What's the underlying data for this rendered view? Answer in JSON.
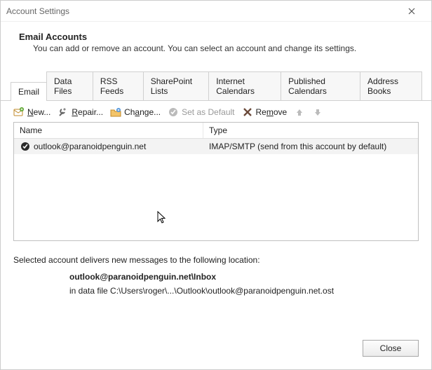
{
  "window": {
    "title": "Account Settings"
  },
  "header": {
    "heading": "Email Accounts",
    "sub": "You can add or remove an account. You can select an account and change its settings."
  },
  "tabs": [
    {
      "id": "email",
      "label": "Email",
      "active": true
    },
    {
      "id": "data-files",
      "label": "Data Files"
    },
    {
      "id": "rss",
      "label": "RSS Feeds"
    },
    {
      "id": "sharepoint",
      "label": "SharePoint Lists"
    },
    {
      "id": "internet-cals",
      "label": "Internet Calendars"
    },
    {
      "id": "pub-cals",
      "label": "Published Calendars"
    },
    {
      "id": "address-books",
      "label": "Address Books"
    }
  ],
  "toolbar": {
    "new": "New...",
    "repair": "Repair...",
    "change": "Change...",
    "set_default": "Set as Default",
    "remove": "Remove"
  },
  "columns": {
    "name": "Name",
    "type": "Type"
  },
  "accounts": [
    {
      "name": "outlook@paranoidpenguin.net",
      "type": "IMAP/SMTP (send from this account by default)"
    }
  ],
  "info": {
    "line1": "Selected account delivers new messages to the following location:",
    "line2": "outlook@paranoidpenguin.net\\Inbox",
    "line3": "in data file C:\\Users\\roger\\...\\Outlook\\outlook@paranoidpenguin.net.ost"
  },
  "footer": {
    "close": "Close"
  }
}
